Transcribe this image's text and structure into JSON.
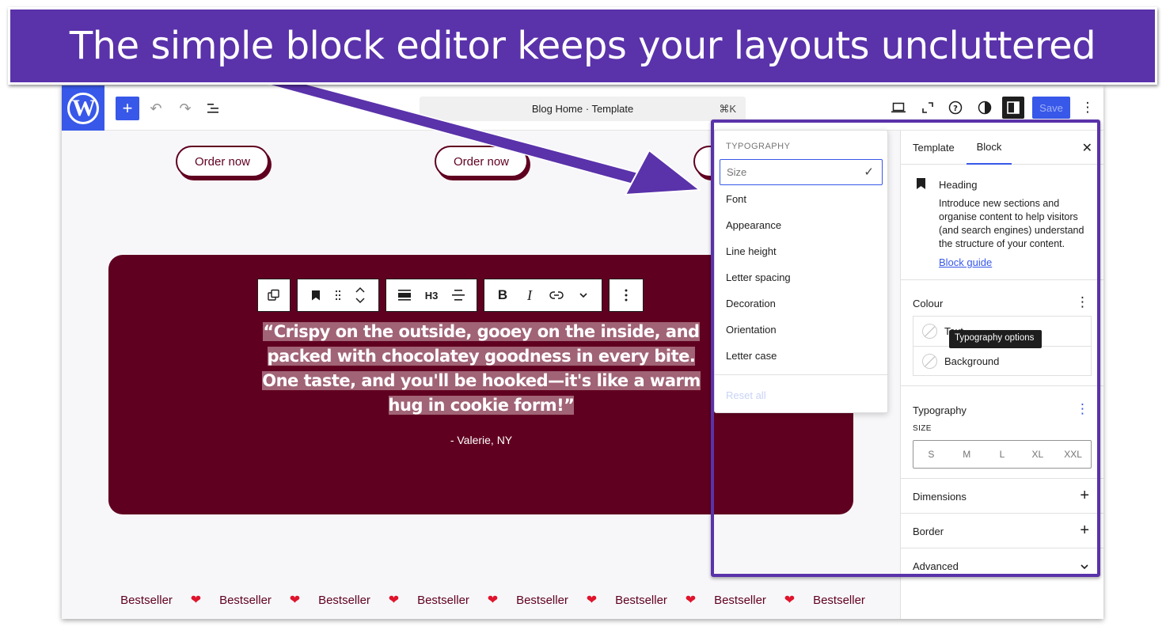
{
  "banner": {
    "text": "The simple block editor keeps your layouts uncluttered"
  },
  "topbar": {
    "logo": "W",
    "add_label": "+",
    "undo_icon": "↶",
    "redo_icon": "↷",
    "listview_icon": "☰",
    "command_bar": {
      "title": "Blog Home · Template",
      "shortcut": "⌘K"
    },
    "save_label": "Save",
    "more_icon": "⋮"
  },
  "canvas": {
    "order_buttons": [
      "Order now",
      "Order now"
    ],
    "block_toolbar": {
      "heading_level": "H3",
      "bold": "B",
      "italic": "I"
    },
    "quote": "“Crispy on the outside, gooey on the inside, and packed with chocolatey goodness in every bite. One taste, and you'll be hooked—it's like a warm hug in cookie form!”",
    "quote_lines": [
      "“Crispy on the outside, gooey on the inside, and",
      "packed with chocolatey goodness in every bite.",
      "One taste, and you'll be hooked—it's like a warm",
      "hug in cookie form!”"
    ],
    "attribution": "- Valerie, NY",
    "marquee": {
      "words": [
        "Bestseller",
        "Bestseller",
        "Bestseller",
        "Bestseller",
        "Bestseller",
        "Bestseller",
        "Bestseller",
        "Bestseller"
      ],
      "separator": "❤"
    }
  },
  "typography_menu": {
    "heading": "TYPOGRAPHY",
    "items": [
      {
        "label": "Size",
        "selected": true
      },
      {
        "label": "Font",
        "selected": false
      },
      {
        "label": "Appearance",
        "selected": false
      },
      {
        "label": "Line height",
        "selected": false
      },
      {
        "label": "Letter spacing",
        "selected": false
      },
      {
        "label": "Decoration",
        "selected": false
      },
      {
        "label": "Orientation",
        "selected": false
      },
      {
        "label": "Letter case",
        "selected": false
      }
    ],
    "check": "✓",
    "reset_label": "Reset all"
  },
  "sidebar": {
    "tabs": [
      {
        "label": "Template",
        "active": false
      },
      {
        "label": "Block",
        "active": true
      }
    ],
    "close_icon": "✕",
    "block_card": {
      "title": "Heading",
      "description": "Introduce new sections and organise content to help visitors (and search engines) understand the structure of your content.",
      "link": "Block guide"
    },
    "colour": {
      "title": "Colour",
      "items": [
        "Text",
        "Background"
      ]
    },
    "typography": {
      "title": "Typography",
      "size_label": "SIZE",
      "sizes": [
        "S",
        "M",
        "L",
        "XL",
        "XXL"
      ],
      "tooltip": "Typography options"
    },
    "panels": [
      {
        "title": "Dimensions",
        "action": "+"
      },
      {
        "title": "Border",
        "action": "+"
      },
      {
        "title": "Advanced",
        "action": "⌄"
      }
    ]
  },
  "colors": {
    "accent": "#3858e9",
    "brand_maroon": "#600020",
    "annotation_purple": "#5a32aa"
  }
}
